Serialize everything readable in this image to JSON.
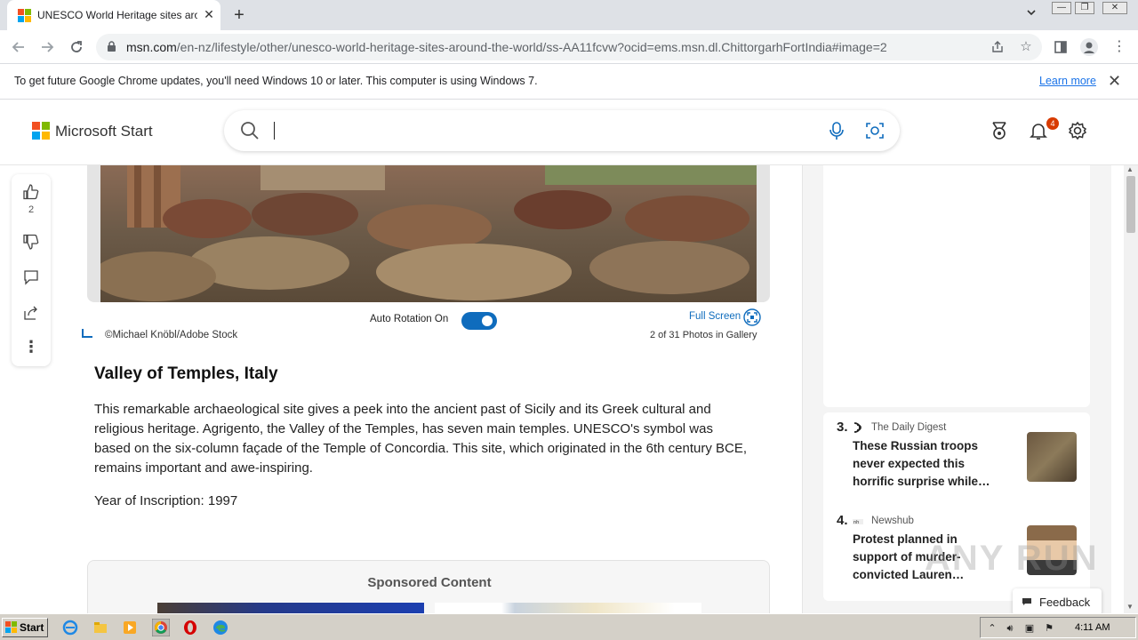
{
  "browser": {
    "tab_title": "UNESCO World Heritage sites around",
    "url_host": "msn.com",
    "url_path": "/en-nz/lifestyle/other/unesco-world-heritage-sites-around-the-world/ss-AA11fcvw?ocid=ems.msn.dl.ChittorgarhFortIndia#image=2",
    "new_tab_label": "+",
    "close_glyph": "✕"
  },
  "infobar": {
    "message": "To get future Google Chrome updates, you'll need Windows 10 or later. This computer is using Windows 7.",
    "link": "Learn more"
  },
  "msn": {
    "brand": "Microsoft Start",
    "notification_count": "4"
  },
  "reactions": {
    "like_count": "2"
  },
  "gallery": {
    "auto_rotation_label": "Auto Rotation On",
    "auto_rotation_on": true,
    "full_screen_label": "Full Screen",
    "credit": "©Michael Knöbl/Adobe Stock",
    "counter": "2 of 31 Photos in Gallery"
  },
  "slide": {
    "title": "Valley of Temples, Italy",
    "body": "This remarkable archaeological site gives a peek into the ancient past of Sicily and its Greek cultural and religious heritage. Agrigento, the Valley of the Temples, has seven main temples. UNESCO's symbol was based on the six-column façade of the Temple of Concordia. This site, which originated in the 6th century BCE, remains important and awe-inspiring.",
    "year": "Year of Inscription: 1997"
  },
  "sponsored": {
    "title": "Sponsored Content"
  },
  "trending": [
    {
      "rank": "3.",
      "source": "The Daily Digest",
      "title": "These Russian troops never expected this horrific surprise while…"
    },
    {
      "rank": "4.",
      "source": "Newshub",
      "title": "Protest planned in support of murder-convicted Lauren…"
    }
  ],
  "feedback": {
    "label": "Feedback"
  },
  "watermark": "ANY RUN",
  "taskbar": {
    "start_label": "Start",
    "clock": "4:11 AM"
  },
  "colors": {
    "accent": "#0f6cbd",
    "link": "#1a73e8",
    "badge": "#d83b01"
  }
}
